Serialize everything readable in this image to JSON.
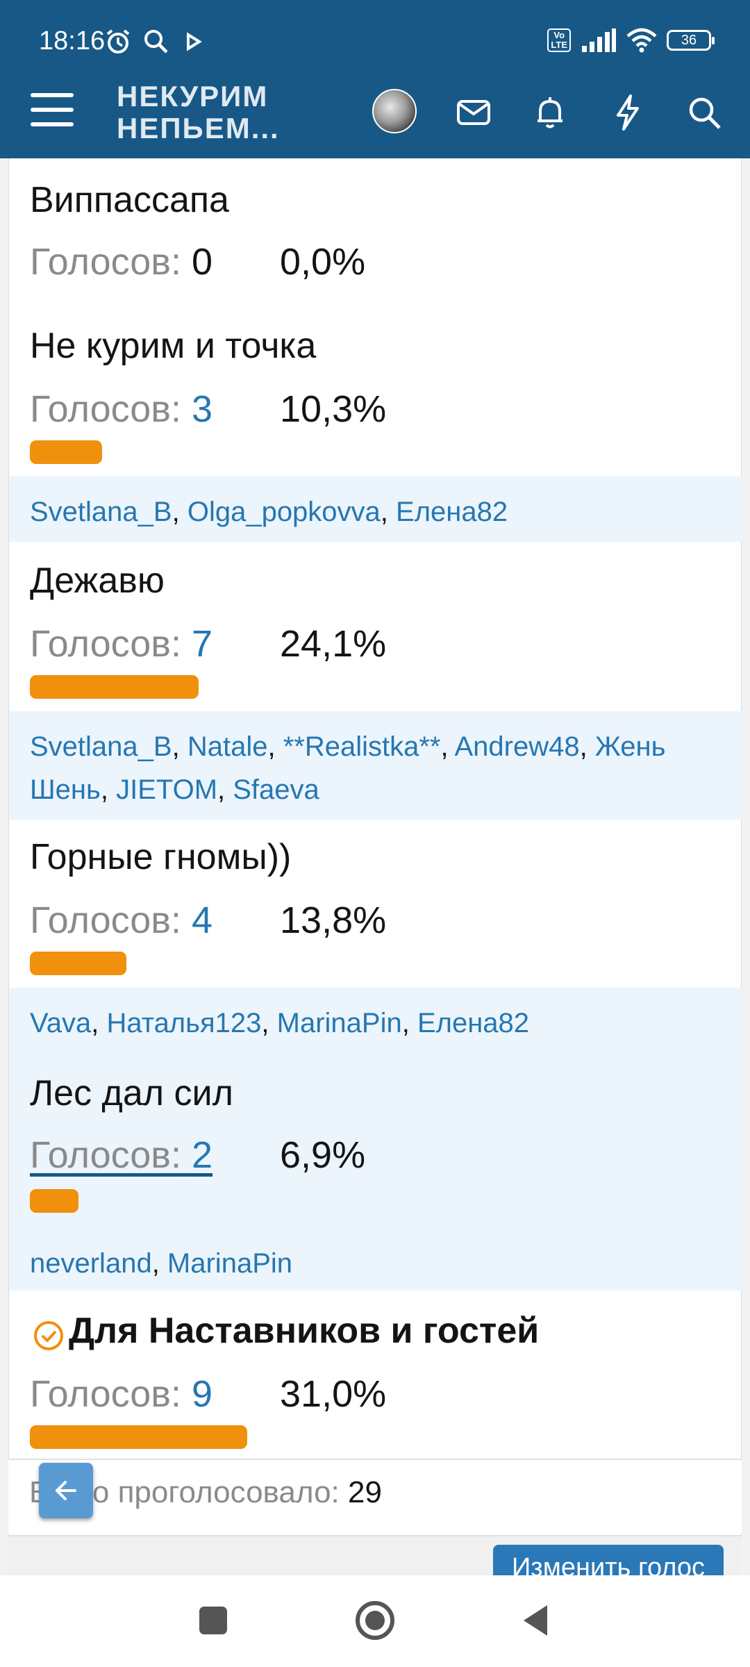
{
  "status_bar": {
    "time": "18:16",
    "volte": "Vo\nLTE",
    "battery": "36",
    "icons": [
      "alarm-icon",
      "search-icon",
      "play-icon",
      "volte-icon",
      "signal-icon",
      "wifi-icon",
      "battery-icon"
    ]
  },
  "app_bar": {
    "logo_line1": "НЕКУРИМ",
    "logo_line2": "НЕПЬЕМ...",
    "icons": [
      "menu-icon",
      "avatar",
      "mail-icon",
      "bell-icon",
      "lightning-icon",
      "search-icon"
    ]
  },
  "poll": {
    "votes_label": "Голосов:",
    "options": [
      {
        "title": "Виппассапа",
        "votes": "0",
        "percent": "0,0%",
        "fraction": 0.0,
        "voters": []
      },
      {
        "title": "Не курим и точка",
        "votes": "3",
        "percent": "10,3%",
        "fraction": 0.103,
        "voters": [
          "Svetlana_B",
          "Olga_popkovva",
          "Елена82"
        ]
      },
      {
        "title": "Дежавю",
        "votes": "7",
        "percent": "24,1%",
        "fraction": 0.241,
        "voters": [
          "Svetlana_B",
          "Natale",
          "**Realistka**",
          "Andrew48",
          "Жень Шень",
          "JIETOM",
          "Sfaeva"
        ]
      },
      {
        "title": "Горные гномы))",
        "votes": "4",
        "percent": "13,8%",
        "fraction": 0.138,
        "voters": [
          "Vava",
          "Наталья123",
          "MarinaPin",
          "Елена82"
        ]
      },
      {
        "title": "Лес дал сил",
        "votes": "2",
        "percent": "6,9%",
        "fraction": 0.069,
        "voters": [
          "neverland",
          "MarinaPin"
        ]
      },
      {
        "title": "Для Наставников и гостей",
        "votes": "9",
        "percent": "31,0%",
        "fraction": 0.31,
        "voters": [],
        "selected": true
      }
    ],
    "total_label": "Всего проголосовало:",
    "total": "29",
    "change_vote_label": "Изменить голос"
  },
  "nav_bar": {
    "icons": [
      "recents-icon",
      "home-icon",
      "back-icon"
    ]
  },
  "colors": {
    "header": "#185886",
    "bar": "#f0900c",
    "link": "#2577b1",
    "voters_bg": "#ecf4fc"
  }
}
